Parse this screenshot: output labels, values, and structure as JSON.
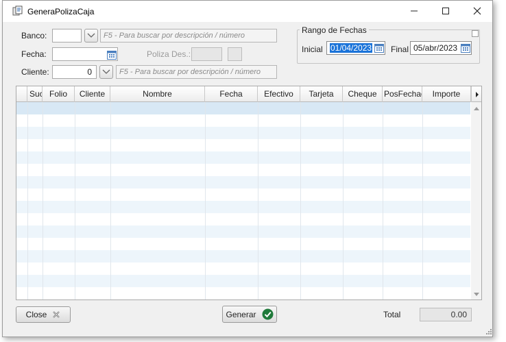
{
  "window": {
    "title": "GeneraPolizaCaja"
  },
  "form": {
    "banco_label": "Banco:",
    "banco_value": "",
    "banco_hint": "F5 - Para buscar por descripción / número",
    "fecha_label": "Fecha:",
    "fecha_value": "",
    "poliza_label": "Poliza Des.:",
    "poliza_value": "",
    "cliente_label": "Cliente:",
    "cliente_value": "0",
    "cliente_hint": "F5 - Para buscar por descripción / número"
  },
  "rango": {
    "title": "Rango de Fechas",
    "inicial_label": "Inicial",
    "inicial_value": "01/04/2023",
    "final_label": "Final",
    "final_value": "05/abr/2023"
  },
  "grid": {
    "columns": [
      "Suc",
      "Folio",
      "Cliente",
      "Nombre",
      "Fecha",
      "Efectivo",
      "Tarjeta",
      "Cheque",
      "PosFechado",
      "Importe"
    ],
    "rows": []
  },
  "footer": {
    "close_label": "Close",
    "generar_label": "Generar",
    "total_label": "Total",
    "total_value": "0.00"
  },
  "colors": {
    "accent_selection": "#1a73d9",
    "row_alt": "#edf5fb",
    "generar_check": "#1f7a3a"
  }
}
